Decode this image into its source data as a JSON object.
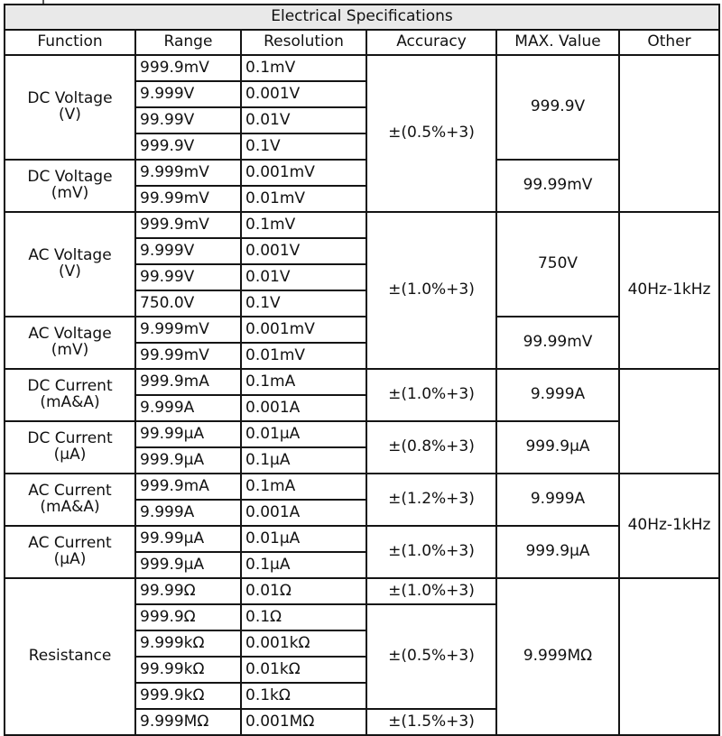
{
  "table": {
    "title": "Electrical Specifications",
    "title_bg": "#e9e9e9",
    "border_color": "#141414",
    "columns": [
      "Function",
      "Range",
      "Resolution",
      "Accuracy",
      "MAX. Value",
      "Other"
    ],
    "sections": [
      {
        "function_line1": "DC Voltage",
        "function_line2": "(V)",
        "rows": [
          {
            "range": "999.9mV",
            "resolution": "0.1mV"
          },
          {
            "range": "9.999V",
            "resolution": "0.001V"
          },
          {
            "range": "99.99V",
            "resolution": "0.01V"
          },
          {
            "range": "999.9V",
            "resolution": "0.1V"
          }
        ],
        "accuracy": "±(0.5%+3)",
        "accuracy_span": 6,
        "max_value": "999.9V",
        "other": "",
        "other_span": 6
      },
      {
        "function_line1": "DC Voltage",
        "function_line2": "(mV)",
        "rows": [
          {
            "range": "9.999mV",
            "resolution": "0.001mV"
          },
          {
            "range": "99.99mV",
            "resolution": "0.01mV"
          }
        ],
        "max_value": "99.99mV"
      },
      {
        "function_line1": "AC Voltage",
        "function_line2": "(V)",
        "rows": [
          {
            "range": "999.9mV",
            "resolution": "0.1mV"
          },
          {
            "range": "9.999V",
            "resolution": "0.001V"
          },
          {
            "range": "99.99V",
            "resolution": "0.01V"
          },
          {
            "range": "750.0V",
            "resolution": "0.1V"
          }
        ],
        "accuracy": "±(1.0%+3)",
        "accuracy_span": 6,
        "max_value": "750V",
        "other": "40Hz-1kHz",
        "other_span": 6
      },
      {
        "function_line1": "AC Voltage",
        "function_line2": "(mV)",
        "rows": [
          {
            "range": "9.999mV",
            "resolution": "0.001mV"
          },
          {
            "range": "99.99mV",
            "resolution": "0.01mV"
          }
        ],
        "max_value": "99.99mV"
      },
      {
        "function_line1": "DC Current",
        "function_line2": "(mA&A)",
        "rows": [
          {
            "range": "999.9mA",
            "resolution": "0.1mA"
          },
          {
            "range": "9.999A",
            "resolution": "0.001A"
          }
        ],
        "accuracy": "±(1.0%+3)",
        "accuracy_span": 2,
        "max_value": "9.999A",
        "other": "",
        "other_span": 4
      },
      {
        "function_line1": "DC Current",
        "function_line2": "(μA)",
        "rows": [
          {
            "range": "99.99μA",
            "resolution": "0.01μA"
          },
          {
            "range": "999.9μA",
            "resolution": "0.1μA"
          }
        ],
        "accuracy": "±(0.8%+3)",
        "accuracy_span": 2,
        "max_value": "999.9μA"
      },
      {
        "function_line1": "AC Current",
        "function_line2": "(mA&A)",
        "rows": [
          {
            "range": "999.9mA",
            "resolution": "0.1mA"
          },
          {
            "range": "9.999A",
            "resolution": "0.001A"
          }
        ],
        "accuracy": "±(1.2%+3)",
        "accuracy_span": 2,
        "max_value": "9.999A",
        "other": "40Hz-1kHz",
        "other_span": 4
      },
      {
        "function_line1": "AC Current",
        "function_line2": "(μA)",
        "rows": [
          {
            "range": "99.99μA",
            "resolution": "0.01μA"
          },
          {
            "range": "999.9μA",
            "resolution": "0.1μA"
          }
        ],
        "accuracy": "±(1.0%+3)",
        "accuracy_span": 2,
        "max_value": "999.9μA"
      },
      {
        "function_line1": "Resistance",
        "function_line2": "",
        "rows": [
          {
            "range": "99.99Ω",
            "resolution": "0.01Ω"
          },
          {
            "range": "999.9Ω",
            "resolution": "0.1Ω"
          },
          {
            "range": "9.999kΩ",
            "resolution": "0.001kΩ"
          },
          {
            "range": "99.99kΩ",
            "resolution": "0.01kΩ"
          },
          {
            "range": "999.9kΩ",
            "resolution": "0.1kΩ"
          },
          {
            "range": "9.999MΩ",
            "resolution": "0.001MΩ"
          }
        ],
        "accuracy_groups": [
          {
            "text": "±(1.0%+3)",
            "span": 1
          },
          {
            "text": "±(0.5%+3)",
            "span": 4
          },
          {
            "text": "±(1.5%+3)",
            "span": 1
          }
        ],
        "max_value": "9.999MΩ",
        "other": "",
        "other_span": 6
      }
    ]
  }
}
